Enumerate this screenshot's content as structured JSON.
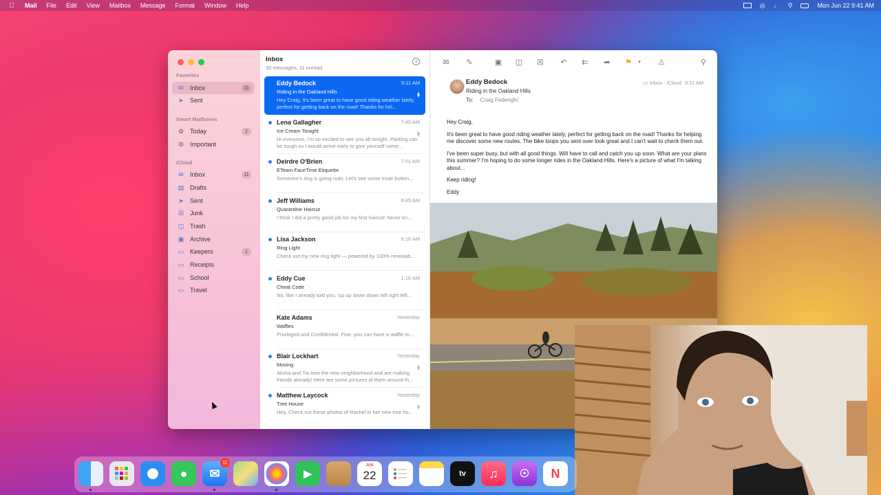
{
  "menubar": {
    "app": "Mail",
    "menus": [
      "File",
      "Edit",
      "View",
      "Mailbox",
      "Message",
      "Format",
      "Window",
      "Help"
    ],
    "datetime": "Mon Jun 22  9:41 AM"
  },
  "sidebar": {
    "favorites_header": "Favorites",
    "favorites": [
      {
        "label": "Inbox",
        "badge": "11"
      },
      {
        "label": "Sent",
        "badge": ""
      }
    ],
    "smart_header": "Smart Mailboxes",
    "smart": [
      {
        "label": "Today",
        "badge": "2"
      },
      {
        "label": "Important",
        "badge": ""
      }
    ],
    "icloud_header": "iCloud",
    "icloud": [
      {
        "label": "Inbox",
        "badge": "11"
      },
      {
        "label": "Drafts",
        "badge": ""
      },
      {
        "label": "Sent",
        "badge": ""
      },
      {
        "label": "Junk",
        "badge": ""
      },
      {
        "label": "Trash",
        "badge": ""
      },
      {
        "label": "Archive",
        "badge": ""
      },
      {
        "label": "Keepers",
        "badge": "1"
      },
      {
        "label": "Receipts",
        "badge": ""
      },
      {
        "label": "School",
        "badge": ""
      },
      {
        "label": "Travel",
        "badge": ""
      }
    ]
  },
  "list": {
    "title": "Inbox",
    "subtitle": "30 messages, 11 unread",
    "messages": [
      {
        "from": "Eddy Bedock",
        "time": "9:11 AM",
        "subject": "Riding in the Oakland Hills",
        "preview": "Hey Craig, It's been great to have good riding weather lately, perfect for getting back on the road! Thanks for hel..."
      },
      {
        "from": "Lena Gallagher",
        "time": "7:40 AM",
        "subject": "Ice Cream Tonight",
        "preview": "Hi everyone, I'm so excited to see you all tonight. Parking can be tough so I would arrive early to give yourself some..."
      },
      {
        "from": "Deirdre O'Brien",
        "time": "7:01 AM",
        "subject": "ETeam FaceTime Etiquette",
        "preview": "Someone's dog is going nuts. Let's see some mute button..."
      },
      {
        "from": "Jeff Williams",
        "time": "6:45 AM",
        "subject": "Quarantine Haircut",
        "preview": "I think I did a pretty good job for my first haircut! Never kn..."
      },
      {
        "from": "Lisa Jackson",
        "time": "6:16 AM",
        "subject": "Ring Light",
        "preview": "Check out my new ring light — powered by 100% renewab..."
      },
      {
        "from": "Eddy Cue",
        "time": "1:16 AM",
        "subject": "Cheat Code",
        "preview": "No, like I already told you, 'up up down down left right left..."
      },
      {
        "from": "Kate Adams",
        "time": "Yesterday",
        "subject": "Waffles",
        "preview": "Privileged and Confidential. Fine, you can have a waffle m..."
      },
      {
        "from": "Blair Lockhart",
        "time": "Yesterday",
        "subject": "Moving",
        "preview": "Alisha and Tia love the new neighborhood and are making friends already! Here are some pictures of them around th..."
      },
      {
        "from": "Matthew Laycock",
        "time": "Yesterday",
        "subject": "Tree House",
        "preview": "Hey, Check out these photos of Rachel in her new tree ho..."
      }
    ]
  },
  "reader": {
    "from": "Eddy Bedock",
    "subject": "Riding in the Oakland Hills",
    "to_label": "To:",
    "to": "Craig Federighi",
    "mailbox": "Inbox - iCloud",
    "time": "9:11 AM",
    "body": [
      "Hey Craig,",
      "It's been great to have good riding weather lately, perfect for getting back on the road! Thanks for helping me discover some new routes. The bike loops you sent over look great and I can't wait to check them out.",
      "I've been super busy, but with all good things. Will have to call and catch you up soon. What are your plans this summer? I'm hoping to do some longer rides in the Oakland Hills. Here's a picture of what I'm talking about...",
      "Keep riding!",
      "Eddy"
    ]
  },
  "dock": {
    "mail_badge": "11",
    "calendar_month": "JUN",
    "calendar_day": "22",
    "tv_label": "tv"
  }
}
